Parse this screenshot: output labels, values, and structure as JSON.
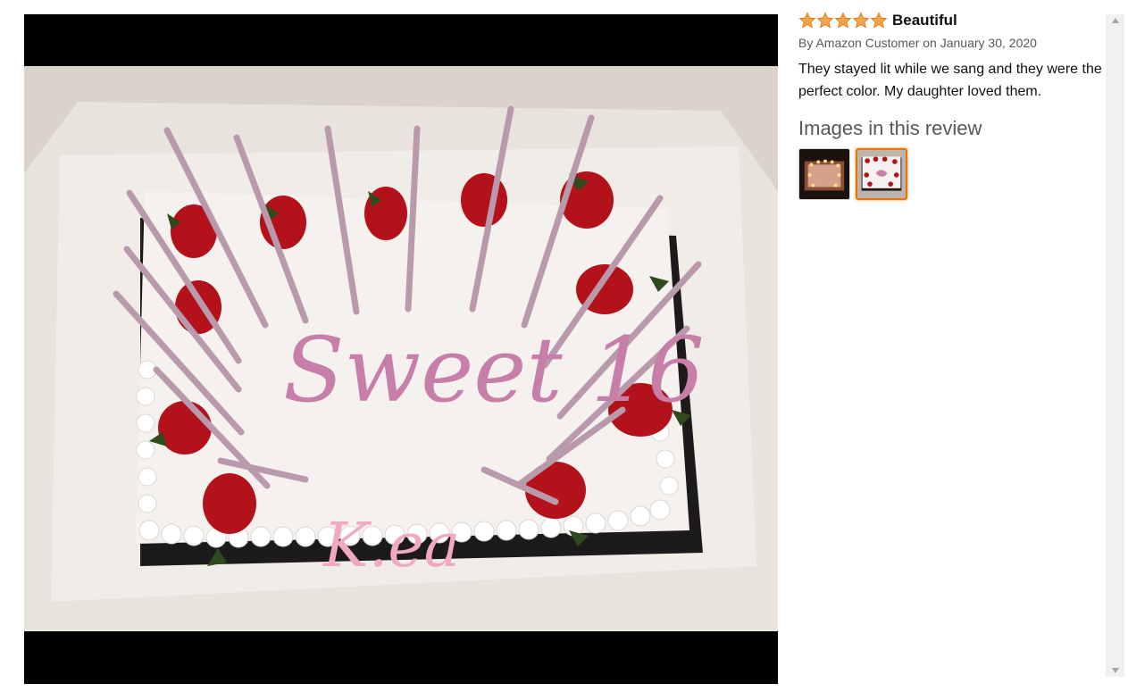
{
  "review": {
    "rating": 5,
    "rating_max": 5,
    "title": "Beautiful",
    "byline": "By Amazon Customer on January 30, 2020",
    "body": "They stayed lit while we sang and they were the perfect color. My daughter loved them."
  },
  "images_section": {
    "heading": "Images in this review",
    "thumbnails": [
      {
        "icon": "cake-lit-candles-thumbnail",
        "selected": false
      },
      {
        "icon": "cake-sweet-16-thumbnail",
        "selected": true
      }
    ]
  },
  "main_image": {
    "icon": "sweet-16-cake-photo",
    "cake_text": "Sweet 16",
    "name_text": "K.ea"
  },
  "colors": {
    "star": "#f3a847",
    "selected_border": "#e77600",
    "viewer_background": "#000000"
  }
}
